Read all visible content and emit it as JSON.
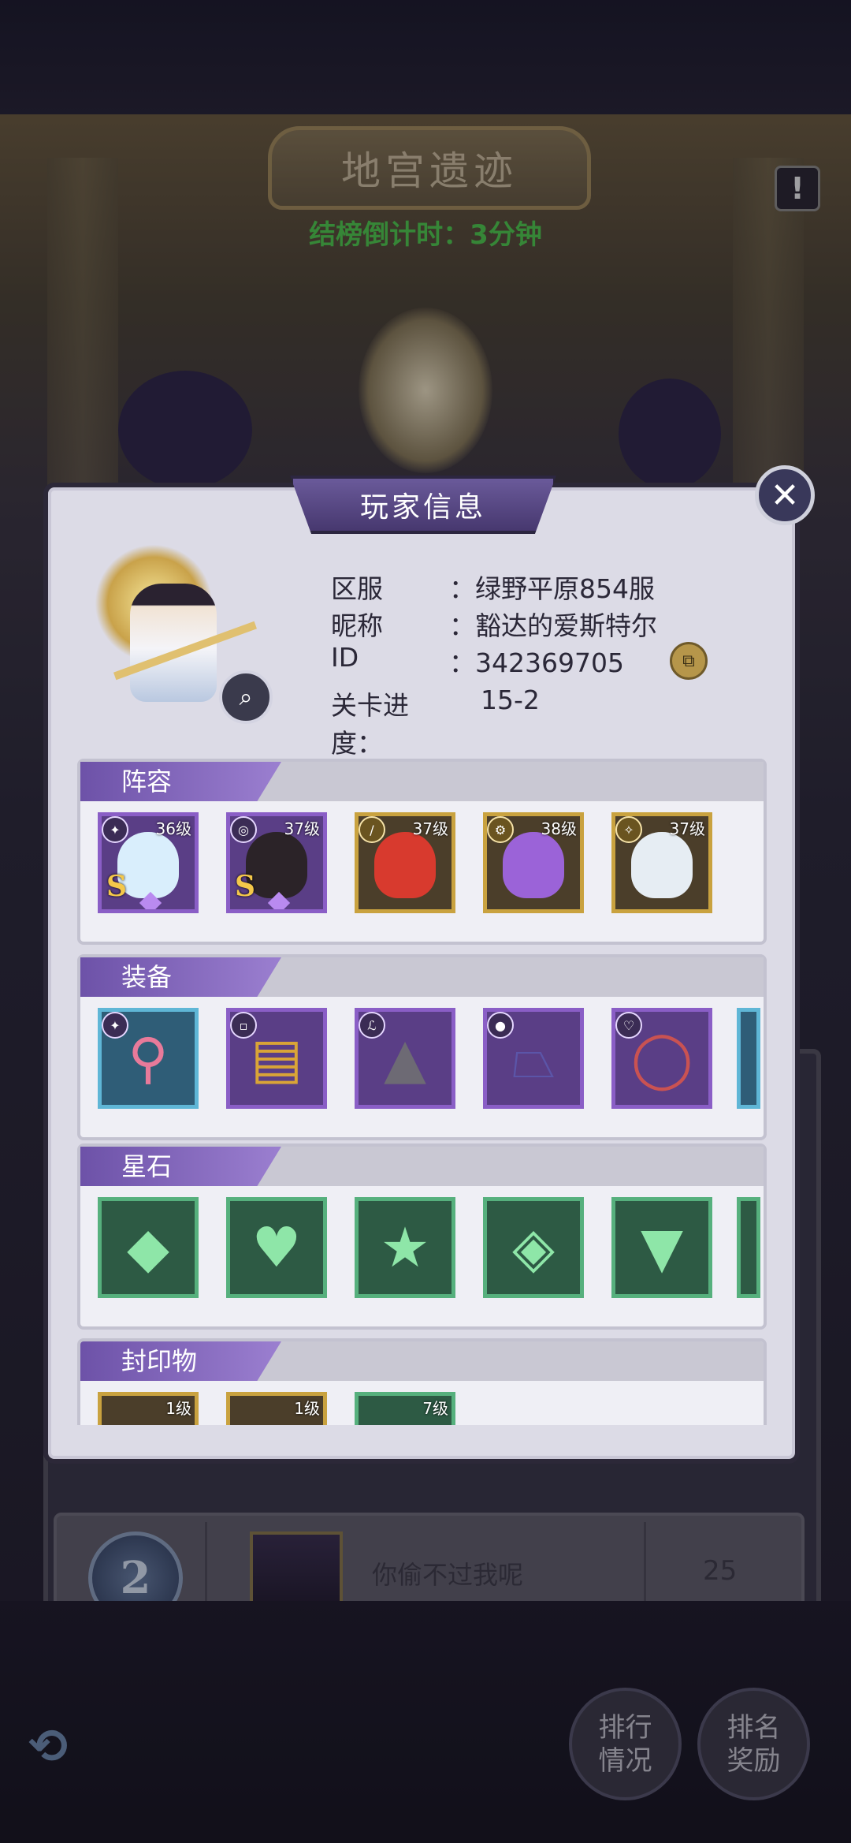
{
  "hall": {
    "title": "地宫遗迹",
    "countdown": "结榜倒计时：3分钟",
    "warn_icon": "!"
  },
  "ranking": {
    "rank": "2",
    "player_name": "你偷不过我呢",
    "score": "25",
    "buttons": [
      {
        "line1": "排行",
        "line2": "情况"
      },
      {
        "line1": "排名",
        "line2": "奖励"
      }
    ]
  },
  "modal": {
    "title": "玩家信息",
    "close_icon": "✕",
    "info": [
      {
        "key": "区服",
        "value": "：绿野平原854服"
      },
      {
        "key": "昵称",
        "value": "：豁达的爱斯特尔"
      },
      {
        "key": "ID",
        "value": "：342369705"
      },
      {
        "key": "关卡进度：",
        "value": "15-2"
      }
    ],
    "sections": {
      "lineup": {
        "title": "阵容",
        "heroes": [
          {
            "level": "36级",
            "rank": "S"
          },
          {
            "level": "37级",
            "rank": "S"
          },
          {
            "level": "37级"
          },
          {
            "level": "38级"
          },
          {
            "level": "37级"
          }
        ]
      },
      "equipment": {
        "title": "装备"
      },
      "starstone": {
        "title": "星石"
      },
      "seal": {
        "title": "封印物",
        "items": [
          {
            "level": "1级"
          },
          {
            "level": "1级"
          },
          {
            "level": "7级"
          }
        ]
      }
    }
  },
  "colors": {
    "countdown": "#4fc94c",
    "modal_bg": "#dcdbe6",
    "section_tab": "#7b5fb8"
  }
}
